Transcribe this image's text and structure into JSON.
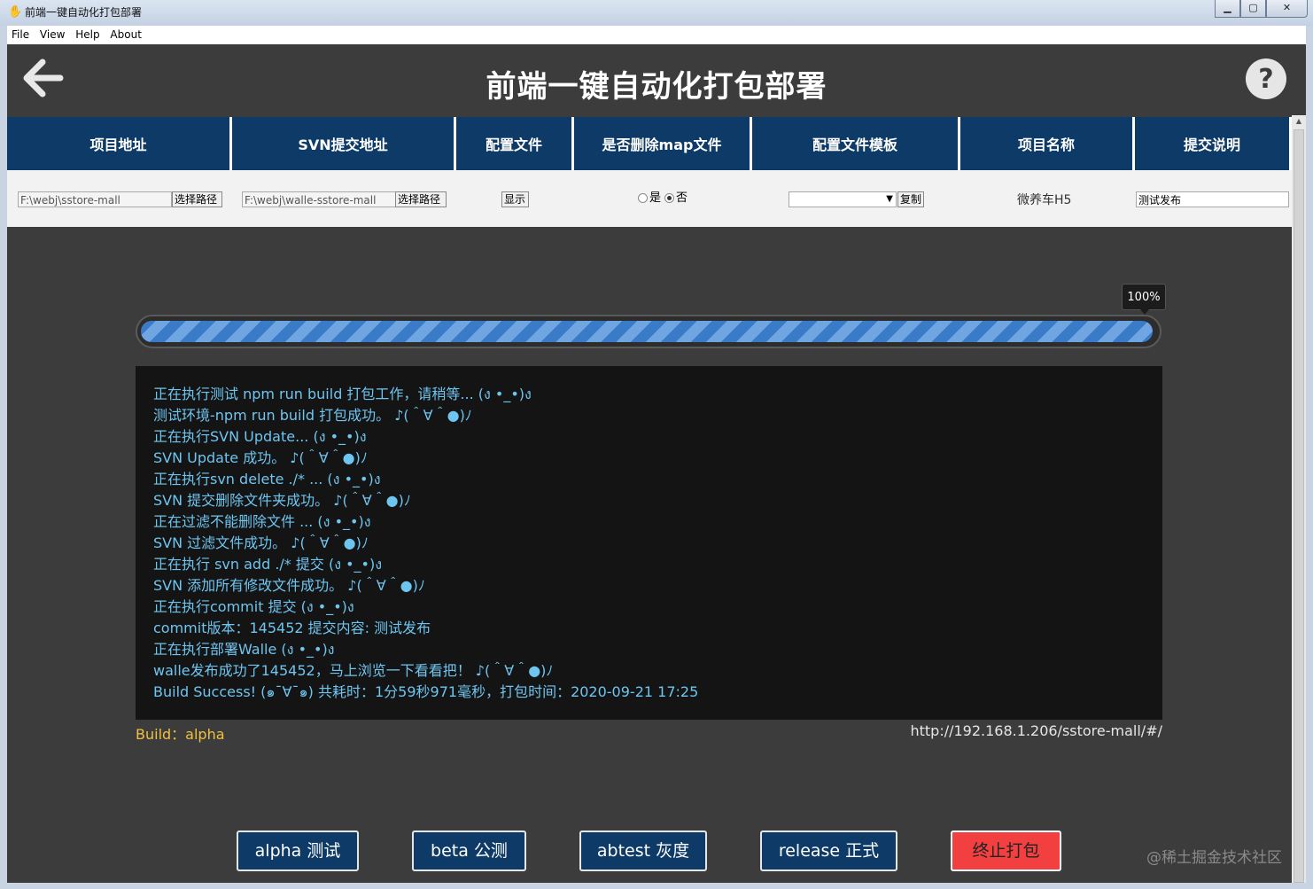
{
  "window": {
    "title": "前端一键自动化打包部署",
    "minimize": "▁",
    "maximize": "▢",
    "close": "✕"
  },
  "menu": [
    "File",
    "View",
    "Help",
    "About"
  ],
  "header": {
    "title": "前端一键自动化打包部署",
    "back_icon": "arrow-left-icon",
    "help_icon": "question-circle-icon"
  },
  "table": {
    "columns": [
      "项目地址",
      "SVN提交地址",
      "配置文件",
      "是否删除map文件",
      "配置文件模板",
      "项目名称",
      "提交说明"
    ],
    "row": {
      "project_path": "F:\\webj\\sstore-mall",
      "project_path_btn": "选择路径",
      "svn_path": "F:\\webj\\walle-sstore-mall",
      "svn_path_btn": "选择路径",
      "config_btn": "显示",
      "delete_map_yes": "是",
      "delete_map_no": "否",
      "delete_map_selected": "否",
      "template_value": "",
      "template_copy_btn": "复制",
      "project_name": "微养车H5",
      "commit_message": "测试发布"
    }
  },
  "progress": {
    "percent": 100,
    "label": "100%"
  },
  "log": [
    "正在执行测试  npm run build  打包工作，请稍等... (ง •_•)ง",
    "测试环境-npm run build 打包成功。 ♪(＾∀＾●)ﾉ",
    "正在执行SVN Update... (ง •_•)ง",
    "SVN Update 成功。 ♪(＾∀＾●)ﾉ",
    "正在执行svn delete ./* ... (ง •_•)ง",
    "SVN 提交删除文件夹成功。 ♪(＾∀＾●)ﾉ",
    "正在过滤不能删除文件 ... (ง •_•)ง",
    "SVN 过滤文件成功。 ♪(＾∀＾●)ﾉ",
    "正在执行 svn add ./* 提交 (ง •_•)ง",
    "SVN 添加所有修改文件成功。 ♪(＾∀＾●)ﾉ",
    "正在执行commit 提交 (ง •_•)ง",
    "commit版本：145452 提交内容: 测试发布",
    "正在执行部署Walle (ง •_•)ง",
    "walle发布成功了145452，马上浏览一下看看把！ ♪(＾∀＾●)ﾉ",
    "Build Success! (๑¯∀¯๑) 共耗时：1分59秒971毫秒，打包时间：2020-09-21 17:25"
  ],
  "build_label": "Build：alpha",
  "url": "http://192.168.1.206/sstore-mall/#/",
  "actions": {
    "alpha": "alpha 测试",
    "beta": "beta 公测",
    "abtest": "abtest 灰度",
    "release": "release 正式",
    "stop": "终止打包"
  },
  "watermark": "@稀土掘金技术社区",
  "colors": {
    "header_bg": "#0d3a66",
    "log_text": "#6ec5f0",
    "build_label": "#f0c040",
    "stop_button": "#f24040"
  }
}
